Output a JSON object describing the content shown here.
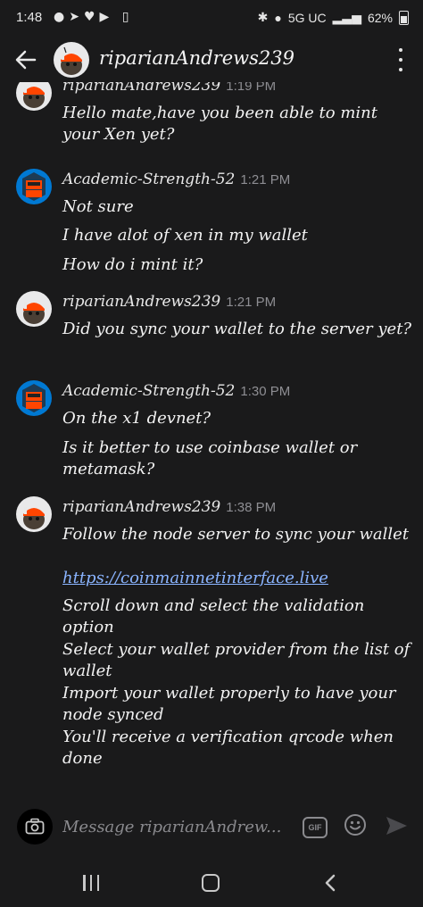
{
  "status_bar": {
    "time": "1:48",
    "network": "5G UC",
    "battery": "62%"
  },
  "header": {
    "title": "riparianAndrews239"
  },
  "messages": [
    {
      "author": "riparianAndrews239",
      "time": "1:19 PM",
      "avatar": "snoo-avatar",
      "lines": [
        "Hello mate,have you been able to mint your Xen yet?"
      ]
    },
    {
      "author": "Academic-Strength-52",
      "time": "1:21 PM",
      "avatar": "robot-avatar",
      "lines": [
        "Not sure",
        "I have alot of xen in my wallet",
        "How do i mint it?"
      ]
    },
    {
      "author": "riparianAndrews239",
      "time": "1:21 PM",
      "avatar": "snoo-avatar",
      "lines": [
        "Did you sync your wallet to the server yet?"
      ]
    },
    {
      "author": "Academic-Strength-52",
      "time": "1:30 PM",
      "avatar": "robot-avatar",
      "lines": [
        "On the x1 devnet?",
        "Is it better to use coinbase wallet or metamask?"
      ]
    },
    {
      "author": "riparianAndrews239",
      "time": "1:38 PM",
      "avatar": "snoo-avatar",
      "lines": [
        "Follow the node server to sync your wallet",
        "https://coinmainnetinterface.live",
        "Scroll down and select the validation option",
        "Select your wallet provider from the list of wallet",
        "Import your wallet properly to have your node synced",
        "You'll receive a verification qrcode when done"
      ]
    }
  ],
  "composer": {
    "placeholder": "Message riparianAndrew...",
    "gif_label": "GIF"
  },
  "colors": {
    "background": "#1a1a1b",
    "link": "#8ab4ff",
    "timestamp": "#8e8e93",
    "robot_avatar_bg": "#0079d3"
  },
  "icons": [
    "camera-icon",
    "gif-icon",
    "emoji-icon",
    "send-icon",
    "back-arrow-icon",
    "more-options-icon"
  ]
}
